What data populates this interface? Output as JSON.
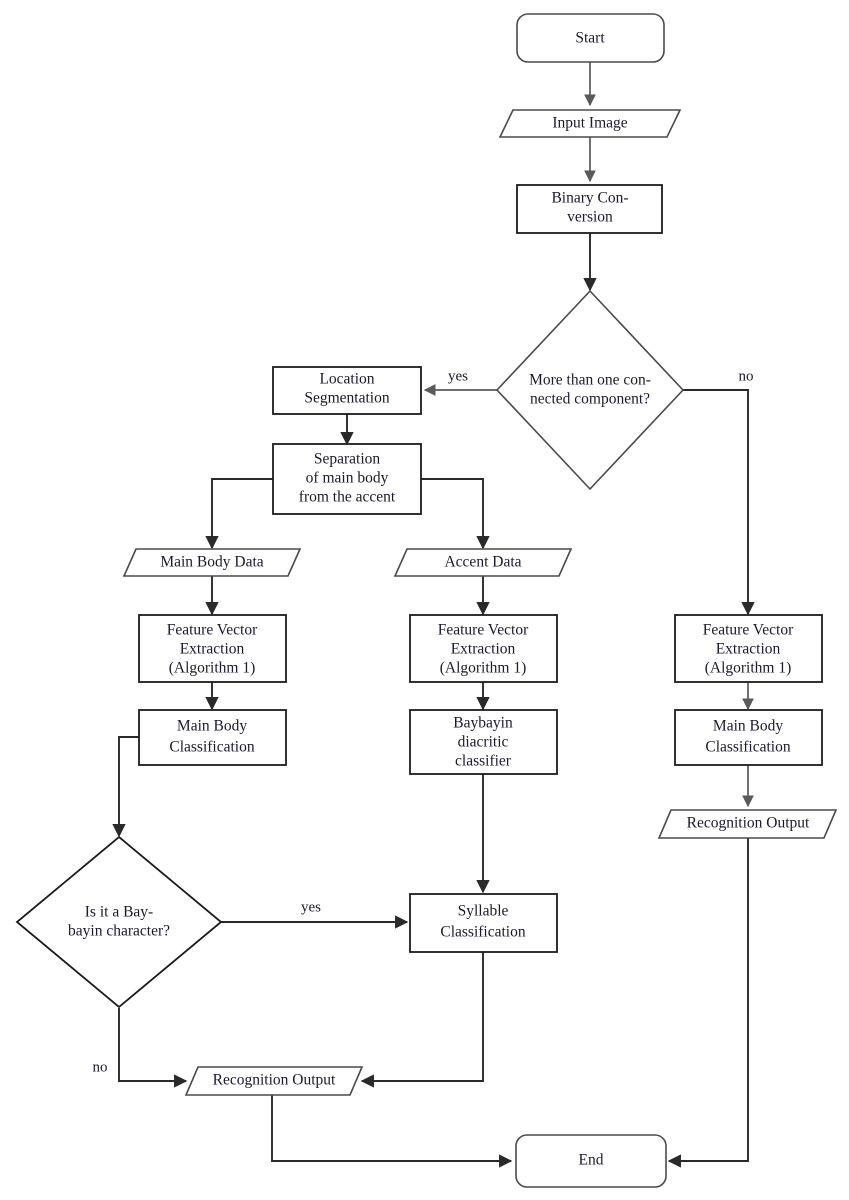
{
  "diagram": {
    "title": "Baybayin character recognition flowchart",
    "colors": {
      "shape_stroke_light": "#4a4a4a",
      "shape_stroke_dark": "#1c1c1c",
      "connector_light": "#5a5a5a",
      "connector_dark": "#2a2a2a",
      "text": "#1a1a2e",
      "background": "#ffffff"
    },
    "nodes": {
      "start": {
        "label": "Start",
        "shape": "terminator"
      },
      "input_image": {
        "label": "Input Image",
        "shape": "parallelogram"
      },
      "binary_conversion": {
        "line1": "Binary Con-",
        "line2": "version",
        "shape": "process"
      },
      "decision_connected": {
        "line1": "More than one con-",
        "line2": "nected component?",
        "shape": "decision"
      },
      "location_segmentation": {
        "line1": "Location",
        "line2": "Segmentation",
        "shape": "process"
      },
      "separation": {
        "line1": "Separation",
        "line2": "of main body",
        "line3": "from the accent",
        "shape": "process"
      },
      "main_body_data": {
        "label": "Main Body Data",
        "shape": "parallelogram"
      },
      "accent_data": {
        "label": "Accent Data",
        "shape": "parallelogram"
      },
      "fve_left": {
        "line1": "Feature Vector",
        "line2": "Extraction",
        "line3": "(Algorithm 1)",
        "shape": "process"
      },
      "fve_middle": {
        "line1": "Feature Vector",
        "line2": "Extraction",
        "line3": "(Algorithm 1)",
        "shape": "process"
      },
      "fve_right": {
        "line1": "Feature Vector",
        "line2": "Extraction",
        "line3": "(Algorithm 1)",
        "shape": "process"
      },
      "main_body_classification_left": {
        "line1": "Main Body",
        "line2": "Classification",
        "shape": "process"
      },
      "baybayin_diacritic_classifier": {
        "line1": "Baybayin",
        "line2": "diacritic",
        "line3": "classifier",
        "shape": "process"
      },
      "main_body_classification_right": {
        "line1": "Main Body",
        "line2": "Classification",
        "shape": "process"
      },
      "decision_baybayin": {
        "line1": "Is it a Bay-",
        "line2": "bayin character?",
        "shape": "decision"
      },
      "syllable_classification": {
        "line1": "Syllable",
        "line2": "Classification",
        "shape": "process"
      },
      "recognition_output_right": {
        "label": "Recognition Output",
        "shape": "parallelogram"
      },
      "recognition_output_bottom": {
        "label": "Recognition Output",
        "shape": "parallelogram"
      },
      "end": {
        "label": "End",
        "shape": "terminator"
      }
    },
    "edge_labels": {
      "decision_connected_yes": "yes",
      "decision_connected_no": "no",
      "decision_baybayin_yes": "yes",
      "decision_baybayin_no": "no"
    }
  }
}
